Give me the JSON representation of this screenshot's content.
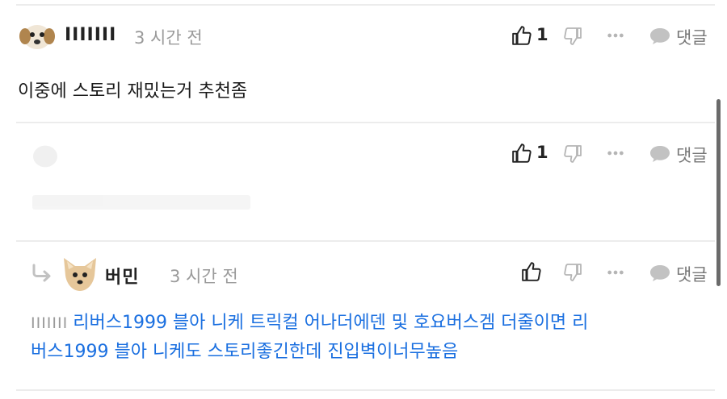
{
  "comments": [
    {
      "nickname": "IIIIIII",
      "time": "3 시간 전",
      "likes": "1",
      "reply_label": "댓글",
      "text": "이중에 스토리 재밌는거 추천좀"
    },
    {
      "likes": "1",
      "reply_label": "댓글"
    },
    {
      "nickname": "버민",
      "time": "3 시간 전",
      "reply_label": "댓글",
      "mention": "IIIIIII",
      "text_line1": "리버스1999 블아 니케 트릭컬 어나더에덴 및 호요버스겜 더줄이면 리",
      "text_line2": "버스1999 블아 니케도 스토리좋긴한데 진입벽이너무높음"
    }
  ],
  "colors": {
    "accent": "#1a6fe0",
    "muted": "#9a9a9a"
  }
}
